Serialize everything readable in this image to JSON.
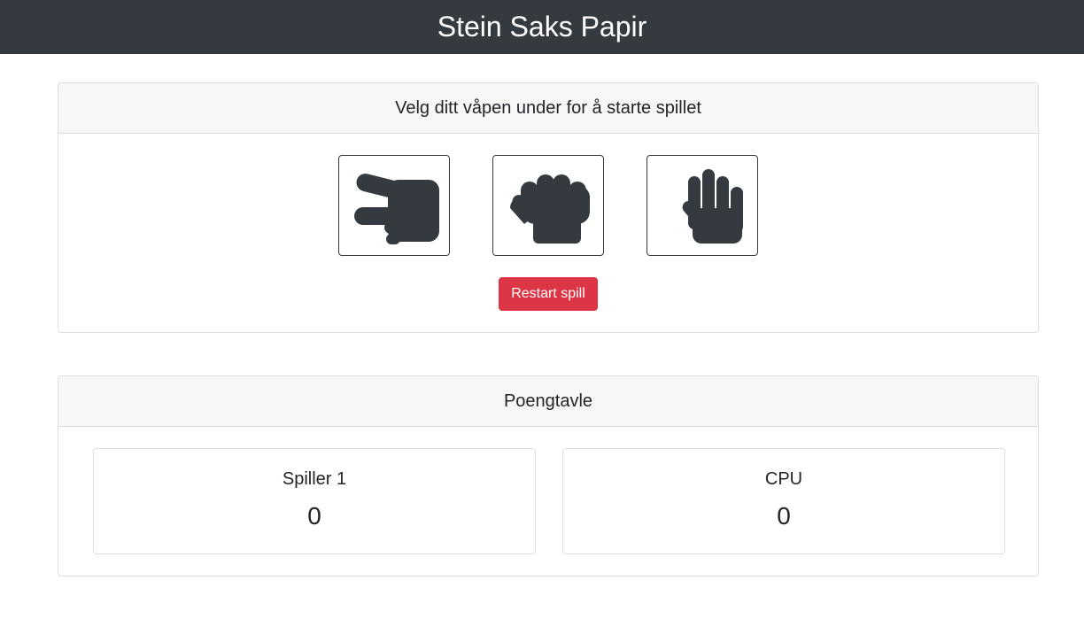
{
  "header": {
    "title": "Stein Saks Papir"
  },
  "game": {
    "prompt": "Velg ditt våpen under for å starte spillet",
    "weapons": [
      {
        "icon": "scissors-hand-icon"
      },
      {
        "icon": "rock-fist-icon"
      },
      {
        "icon": "paper-hand-icon"
      }
    ],
    "restart_label": "Restart spill"
  },
  "scoreboard": {
    "title": "Poengtavle",
    "player": {
      "name": "Spiller 1",
      "score": "0"
    },
    "cpu": {
      "name": "CPU",
      "score": "0"
    }
  },
  "colors": {
    "navbar": "#343a40",
    "icon": "#343a40",
    "danger": "#dc3545",
    "card_header": "#f7f7f7"
  }
}
